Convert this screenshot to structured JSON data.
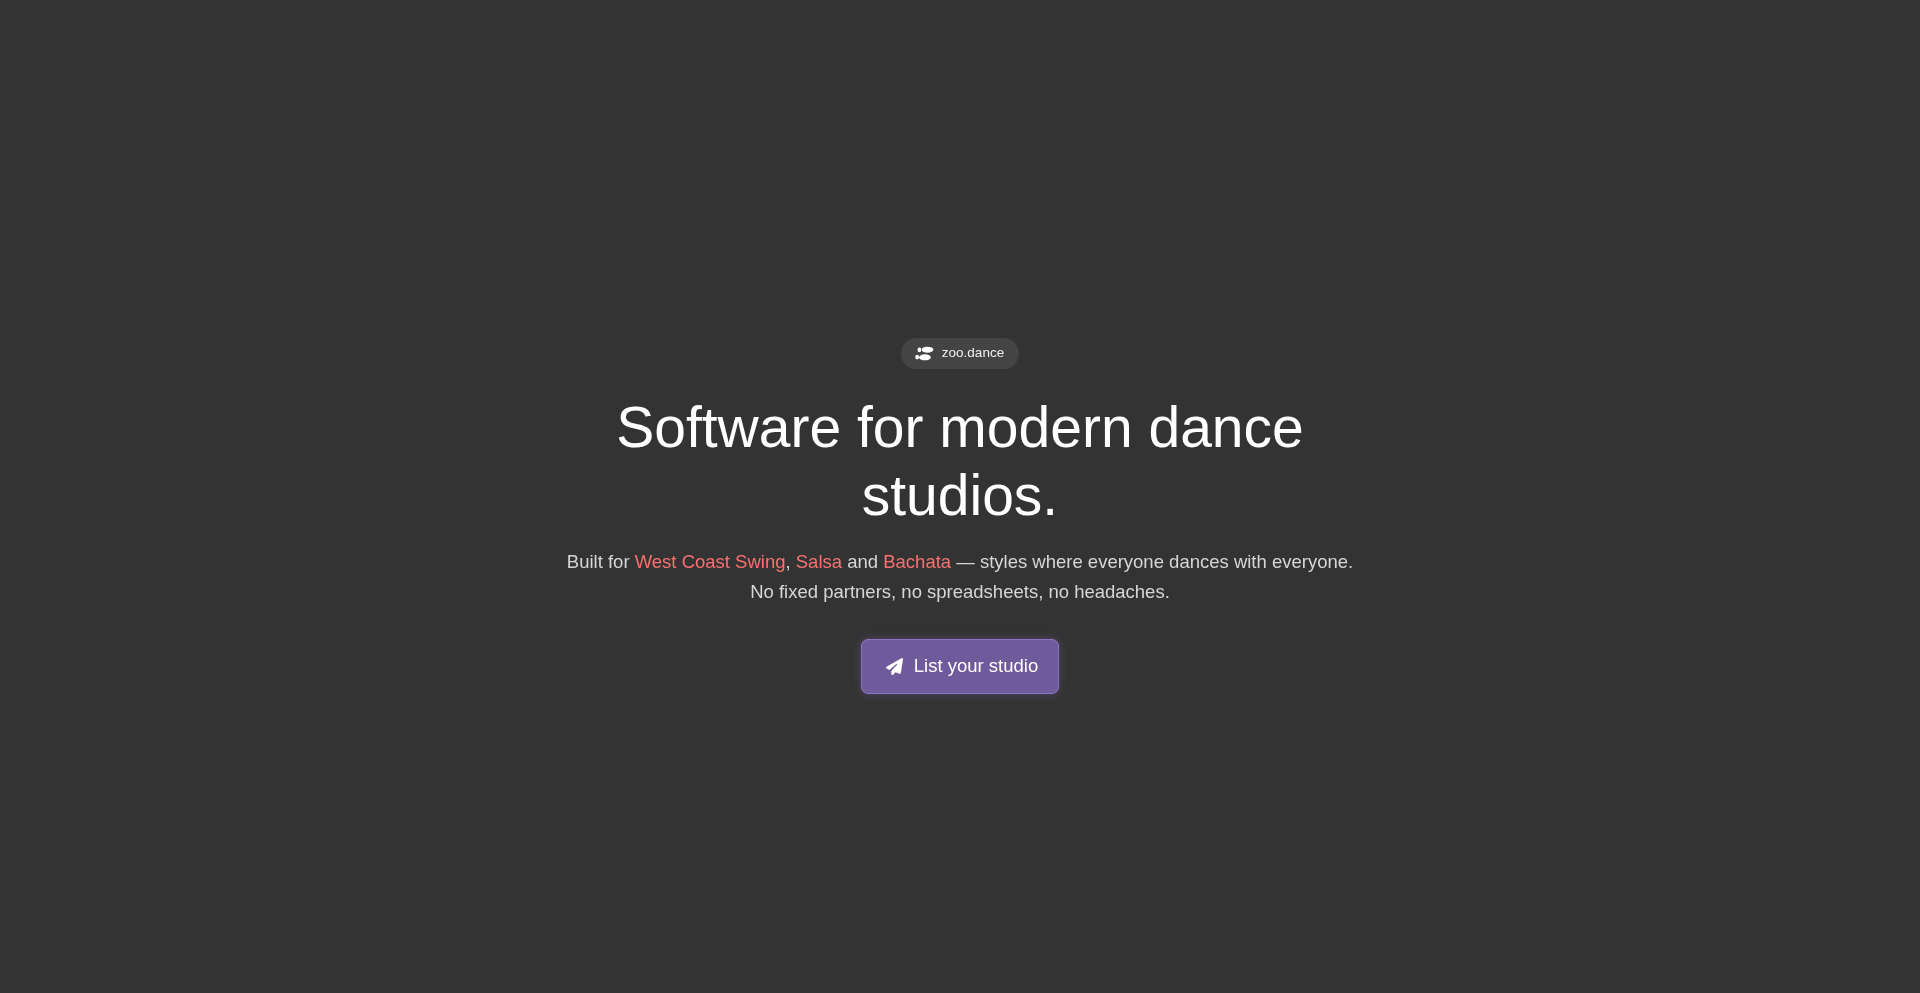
{
  "badge": {
    "label": "zoo.dance"
  },
  "headline": "Software for modern dance studios.",
  "subtitle": {
    "segments": [
      {
        "text": "Built for ",
        "kind": "plain"
      },
      {
        "text": "West Coast Swing",
        "kind": "style"
      },
      {
        "text": ", ",
        "kind": "plain"
      },
      {
        "text": "Salsa",
        "kind": "style"
      },
      {
        "text": " and ",
        "kind": "plain"
      },
      {
        "text": "Bachata",
        "kind": "style"
      },
      {
        "text": " — styles where everyone dances with everyone.",
        "kind": "plain"
      }
    ],
    "note": "No fixed partners, no spreadsheets, no headaches."
  },
  "cta_button": {
    "label": "List your studio"
  }
}
